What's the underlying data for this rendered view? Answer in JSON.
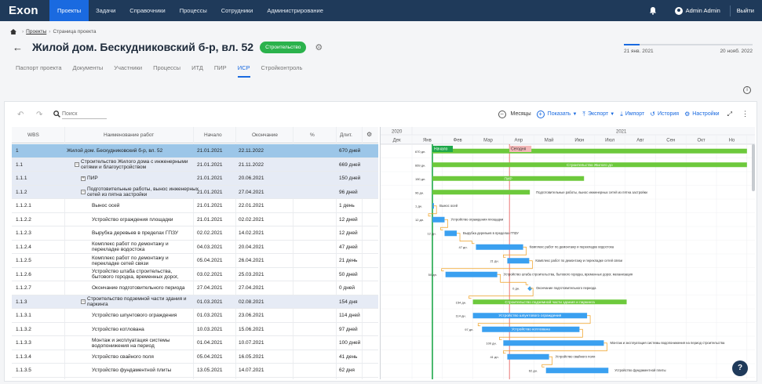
{
  "brand": {
    "logo": "Exon",
    "accent": "#1a6ae0",
    "nav_bg": "#1f3a5a"
  },
  "nav": [
    {
      "label": "Проекты",
      "active": true
    },
    {
      "label": "Задачи",
      "active": false
    },
    {
      "label": "Справочники",
      "active": false
    },
    {
      "label": "Процессы",
      "active": false
    },
    {
      "label": "Сотрудники",
      "active": false
    },
    {
      "label": "Администрирование",
      "active": false
    }
  ],
  "user": {
    "name": "Admin Admin",
    "logout": "Выйти",
    "bell_icon": "bell-icon"
  },
  "breadcrumb": {
    "root": "Проекты",
    "current": "Страница проекта"
  },
  "project": {
    "title": "Жилой дом. Бескудниковский б-р, вл. 52",
    "status": "Строительство",
    "timeline": {
      "start": "21 янв. 2021",
      "end": "20 нояб. 2022",
      "progress_fraction": 0.12
    }
  },
  "tabs": [
    {
      "label": "Паспорт проекта",
      "active": false
    },
    {
      "label": "Документы",
      "active": false
    },
    {
      "label": "Участники",
      "active": false
    },
    {
      "label": "Процессы",
      "active": false
    },
    {
      "label": "ИТД",
      "active": false
    },
    {
      "label": "ПИР",
      "active": false
    },
    {
      "label": "ИСР",
      "active": true
    },
    {
      "label": "Стройконтроль",
      "active": false
    }
  ],
  "toolbar": {
    "search_placeholder": "Поиск",
    "scale": "Месяцы",
    "show": "Показать",
    "export": "Экспорт",
    "import": "Импорт",
    "history": "История",
    "settings": "Настройки"
  },
  "columns": {
    "wbs": "WBS",
    "name": "Наименование работ",
    "start": "Начало",
    "end": "Окончание",
    "pct": "%",
    "dur": "Длит."
  },
  "rows": [
    {
      "wbs": "1",
      "name": "Жилой дом. Бескудниковский б-р, вл. 52",
      "start": "21.01.2021",
      "end": "22.11.2022",
      "dur": "670 дней",
      "level": 0,
      "kind": "sel"
    },
    {
      "wbs": "1.1",
      "name": "Строительство Жилого дома с инженерными сетями и благоустройством",
      "start": "21.01.2021",
      "end": "21.11.2022",
      "dur": "669 дней",
      "level": 1,
      "kind": "grp",
      "toggle": "−"
    },
    {
      "wbs": "1.1.1",
      "name": "ПИР",
      "start": "21.01.2021",
      "end": "20.06.2021",
      "dur": "150 дней",
      "level": 2,
      "kind": "grp",
      "toggle": "+"
    },
    {
      "wbs": "1.1.2",
      "name": "Подготовительные работы, вынос инженерных сетей из пятна застройки",
      "start": "21.01.2021",
      "end": "27.04.2021",
      "dur": "96 дней",
      "level": 2,
      "kind": "grp",
      "toggle": "−"
    },
    {
      "wbs": "1.1.2.1",
      "name": "Вынос осей",
      "start": "21.01.2021",
      "end": "22.01.2021",
      "dur": "1 день",
      "level": 3,
      "kind": "task"
    },
    {
      "wbs": "1.1.2.2",
      "name": "Устройство ограждения площадки",
      "start": "21.01.2021",
      "end": "02.02.2021",
      "dur": "12 дней",
      "level": 3,
      "kind": "task"
    },
    {
      "wbs": "1.1.2.3",
      "name": "Вырубка деревьев в пределах ГПЗУ",
      "start": "02.02.2021",
      "end": "14.02.2021",
      "dur": "12 дней",
      "level": 3,
      "kind": "task"
    },
    {
      "wbs": "1.1.2.4",
      "name": "Комплекс работ по демонтажу и перекладке водостока",
      "start": "04.03.2021",
      "end": "20.04.2021",
      "dur": "47 дней",
      "level": 3,
      "kind": "task"
    },
    {
      "wbs": "1.1.2.5",
      "name": "Комплекс работ по демонтажу и перекладке сетей связи",
      "start": "05.04.2021",
      "end": "26.04.2021",
      "dur": "21 день",
      "level": 3,
      "kind": "task"
    },
    {
      "wbs": "1.1.2.6",
      "name": "Устройство штаба строительства, бытового городка, временных дорог,",
      "start": "03.02.2021",
      "end": "25.03.2021",
      "dur": "50 дней",
      "level": 3,
      "kind": "task"
    },
    {
      "wbs": "1.1.2.7",
      "name": "Окончание подготовительного периода",
      "start": "27.04.2021",
      "end": "27.04.2021",
      "dur": "0 дней",
      "level": 3,
      "kind": "task"
    },
    {
      "wbs": "1.1.3",
      "name": "Строительство подземной части здания и паркинга",
      "start": "01.03.2021",
      "end": "02.08.2021",
      "dur": "154 дня",
      "level": 2,
      "kind": "grp",
      "toggle": "−"
    },
    {
      "wbs": "1.1.3.1",
      "name": "Устройство шпунтового ограждения",
      "start": "01.03.2021",
      "end": "23.06.2021",
      "dur": "114 дней",
      "level": 3,
      "kind": "task"
    },
    {
      "wbs": "1.1.3.2",
      "name": "Устройство котлована",
      "start": "10.03.2021",
      "end": "15.06.2021",
      "dur": "97 дней",
      "level": 3,
      "kind": "task"
    },
    {
      "wbs": "1.1.3.3",
      "name": "Монтаж и эксплуатация системы водопонижения на период",
      "start": "01.04.2021",
      "end": "10.07.2021",
      "dur": "100 дней",
      "level": 3,
      "kind": "task"
    },
    {
      "wbs": "1.1.3.4",
      "name": "Устройство свайного поля",
      "start": "05.04.2021",
      "end": "16.05.2021",
      "dur": "41 день",
      "level": 3,
      "kind": "task"
    },
    {
      "wbs": "1.1.3.5",
      "name": "Устройство фундаментной плиты",
      "start": "13.05.2021",
      "end": "14.07.2021",
      "dur": "62 дня",
      "level": 3,
      "kind": "task"
    }
  ],
  "gantt": {
    "years": [
      "2020",
      "2021"
    ],
    "months": [
      "Дек",
      "Янв",
      "Фев",
      "Мар",
      "Апр",
      "Май",
      "Июн",
      "Июл",
      "Авг",
      "Сен",
      "Окт",
      "Но"
    ],
    "start_label": "Начало",
    "today_label": "Сегодня",
    "colors": {
      "summary": "#6dc93c",
      "task": "#3aa0f0",
      "link": "#f0a020",
      "today": "#e04040",
      "start": "#1fa84a"
    },
    "bars": [
      {
        "row": 0,
        "kind": "summary",
        "start": 1.67,
        "end": 12.0,
        "dur": "670 дн.",
        "inside": ""
      },
      {
        "row": 1,
        "kind": "summary",
        "start": 1.67,
        "end": 12.0,
        "dur": "669 дн.",
        "inside": "Строительство Жилого до"
      },
      {
        "row": 2,
        "kind": "summary",
        "start": 1.67,
        "end": 6.65,
        "dur": "150 дн.",
        "inside": "ПИР"
      },
      {
        "row": 3,
        "kind": "summary",
        "start": 1.67,
        "end": 4.87,
        "dur": "96 дн.",
        "after": "Подготовительные работы, вынос инженерных сетей из пятна застройки"
      },
      {
        "row": 4,
        "kind": "task",
        "start": 1.67,
        "end": 1.7,
        "dur": "1 дн.",
        "after": "Вынос осей"
      },
      {
        "row": 5,
        "kind": "task",
        "start": 1.67,
        "end": 2.07,
        "dur": "12 дн.",
        "after": "Устройство ограждения площадки"
      },
      {
        "row": 6,
        "kind": "task",
        "start": 2.07,
        "end": 2.47,
        "dur": "12 дн.",
        "after": "Вырубка деревьев в пределах ГПЗУ"
      },
      {
        "row": 7,
        "kind": "task",
        "start": 3.1,
        "end": 4.65,
        "dur": "47 дн.",
        "after": "Комплекс работ по демонтажу и перекладке водостока"
      },
      {
        "row": 8,
        "kind": "task",
        "start": 4.13,
        "end": 4.85,
        "dur": "21 дн.",
        "after": "Комплекс работ по демонтажу и перекладке сетей связи"
      },
      {
        "row": 9,
        "kind": "task",
        "start": 2.1,
        "end": 3.8,
        "dur": "50 дн.",
        "after": "Устройство штаба строительства, бытового городка, временных дорог, механизация"
      },
      {
        "row": 10,
        "kind": "milestone",
        "start": 4.87,
        "end": 4.87,
        "dur": "0 дн.",
        "after": "Окончание подготовительного периода"
      },
      {
        "row": 11,
        "kind": "summary",
        "start": 3.0,
        "end": 8.05,
        "dur": "154 дн.",
        "inside": "Строительство подземной части здания и паркинга"
      },
      {
        "row": 12,
        "kind": "task",
        "start": 3.0,
        "end": 6.75,
        "dur": "114 дн.",
        "inside": "Устройство шпунтового ограждения"
      },
      {
        "row": 13,
        "kind": "task",
        "start": 3.3,
        "end": 6.5,
        "dur": "97 дн.",
        "inside": "Устройство котлована"
      },
      {
        "row": 14,
        "kind": "task",
        "start": 4.0,
        "end": 7.3,
        "dur": "100 дн.",
        "after": "Монтаж и эксплуатация системы водопонижения на период строительства"
      },
      {
        "row": 15,
        "kind": "task",
        "start": 4.13,
        "end": 5.5,
        "dur": "41 дн.",
        "after": "Устройство свайного поля"
      },
      {
        "row": 16,
        "kind": "task",
        "start": 5.4,
        "end": 7.45,
        "dur": "62 дн.",
        "after": "Устройство фундаментной плиты"
      }
    ],
    "today_month": 4.2
  }
}
